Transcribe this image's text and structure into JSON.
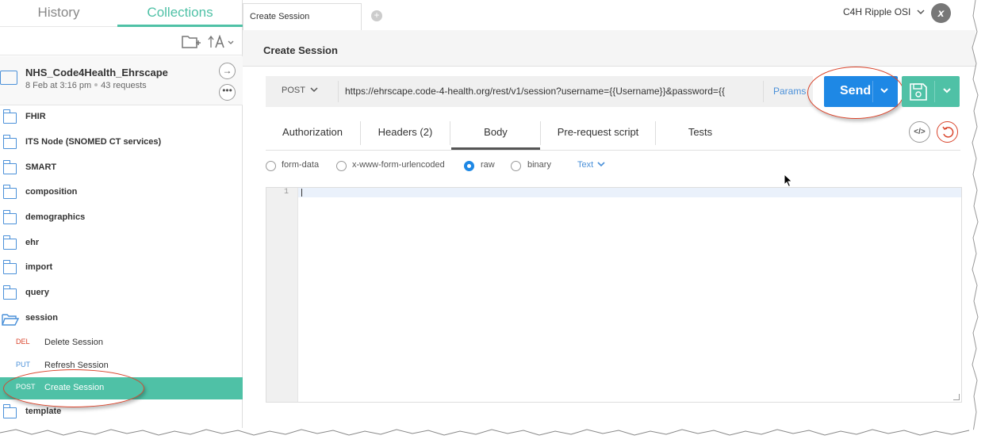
{
  "sidebar": {
    "tabs": {
      "history": "History",
      "collections": "Collections"
    },
    "collection": {
      "name": "NHS_Code4Health_Ehrscape",
      "date": "8 Feb at 3:16 pm",
      "requests": "43 requests"
    },
    "folders": [
      "FHIR",
      "ITS Node (SNOMED CT services)",
      "SMART",
      "composition",
      "demographics",
      "ehr",
      "import",
      "query",
      "session"
    ],
    "session_requests": [
      {
        "method": "DEL",
        "label": "Delete Session",
        "color": "#d9442b"
      },
      {
        "method": "PUT",
        "label": "Refresh Session",
        "color": "#4a90d9"
      },
      {
        "method": "POST",
        "label": "Create Session",
        "color": "#ffffff"
      }
    ],
    "trailing_folder": "template"
  },
  "header": {
    "tab_title": "Create Session",
    "environment": "C4H Ripple OSI",
    "logo_glyph": "x"
  },
  "request": {
    "title": "Create Session",
    "method": "POST",
    "url": "https://ehrscape.code-4-health.org/rest/v1/session?username={{Username}}&password={{",
    "params_label": "Params",
    "send_label": "Send"
  },
  "tabs": [
    {
      "label": "Authorization"
    },
    {
      "label": "Headers (2)"
    },
    {
      "label": "Body"
    },
    {
      "label": "Pre-request script"
    },
    {
      "label": "Tests"
    }
  ],
  "code_button_label": "</>",
  "body_options": [
    {
      "label": "form-data",
      "checked": false
    },
    {
      "label": "x-www-form-urlencoded",
      "checked": false
    },
    {
      "label": "raw",
      "checked": true
    },
    {
      "label": "binary",
      "checked": false
    }
  ],
  "body_format": "Text",
  "editor": {
    "line_number": "1"
  },
  "colors": {
    "accent": "#4fc1a6",
    "send_blue": "#1e88e5",
    "annotation_red": "#d9442b"
  }
}
